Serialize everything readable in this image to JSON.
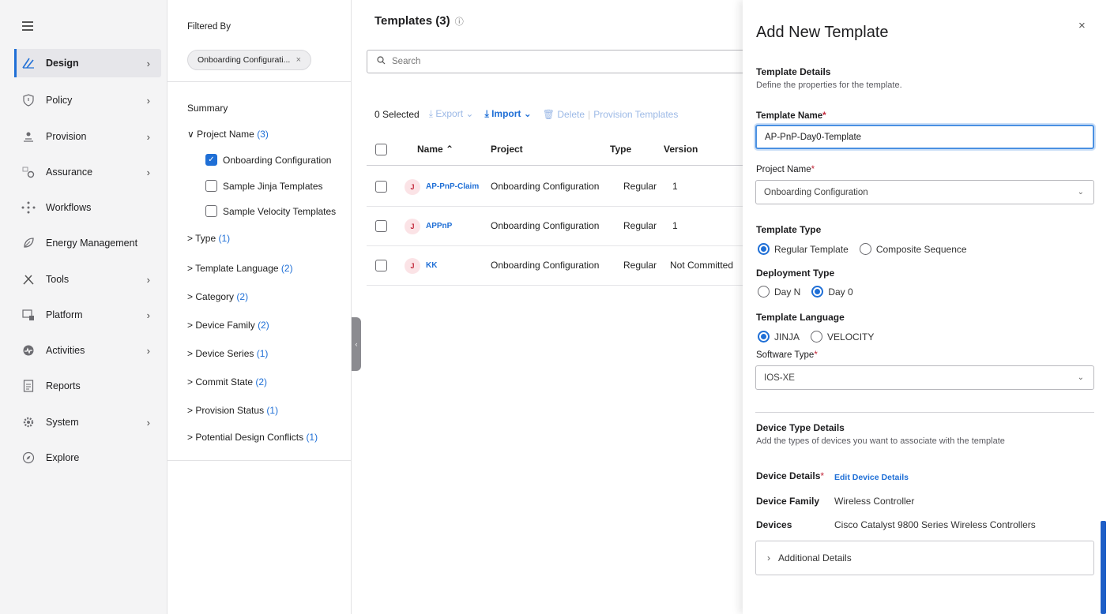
{
  "nav": {
    "items": [
      {
        "label": "Design",
        "icon": "design-icon",
        "chevron": true,
        "active": true
      },
      {
        "label": "Policy",
        "icon": "policy-icon",
        "chevron": true
      },
      {
        "label": "Provision",
        "icon": "provision-icon",
        "chevron": true
      },
      {
        "label": "Assurance",
        "icon": "assurance-icon",
        "chevron": true
      },
      {
        "label": "Workflows",
        "icon": "workflows-icon",
        "chevron": false
      },
      {
        "label": "Energy Management",
        "icon": "energy-icon",
        "chevron": false
      },
      {
        "label": "Tools",
        "icon": "tools-icon",
        "chevron": true
      },
      {
        "label": "Platform",
        "icon": "platform-icon",
        "chevron": true
      },
      {
        "label": "Activities",
        "icon": "activities-icon",
        "chevron": true
      },
      {
        "label": "Reports",
        "icon": "reports-icon",
        "chevron": false
      },
      {
        "label": "System",
        "icon": "system-icon",
        "chevron": true
      },
      {
        "label": "Explore",
        "icon": "explore-icon",
        "chevron": false
      }
    ],
    "chevron_glyph": "›"
  },
  "filter": {
    "title": "Filtered By",
    "chip": "Onboarding Configurati...",
    "chip_close": "×",
    "summary": "Summary",
    "project_name": {
      "label": "Project Name",
      "count": "(3)",
      "arrow": "∨"
    },
    "options": [
      {
        "label": "Onboarding Configuration",
        "checked": true
      },
      {
        "label": "Sample Jinja Templates",
        "checked": false
      },
      {
        "label": "Sample Velocity Templates",
        "checked": false
      }
    ],
    "facets": [
      {
        "label": "Type",
        "count": "(1)"
      },
      {
        "label": "Template Language",
        "count": "(2)"
      },
      {
        "label": "Category",
        "count": "(2)"
      },
      {
        "label": "Device Family",
        "count": "(2)"
      },
      {
        "label": "Device Series",
        "count": "(1)"
      },
      {
        "label": "Commit State",
        "count": "(2)"
      },
      {
        "label": "Provision Status",
        "count": "(1)"
      },
      {
        "label": "Potential Design Conflicts",
        "count": "(1)"
      }
    ],
    "facet_arrow": ">"
  },
  "main": {
    "title": "Templates (3)",
    "search_placeholder": "Search",
    "toolbar": {
      "selected": "0 Selected",
      "export": "⤓ Export ⌄",
      "import": "⤓ Import ⌄",
      "delete": "🗑 Delete",
      "provision": "Provision Templates"
    },
    "columns": [
      "Name ⌃",
      "Project",
      "Type",
      "Version"
    ],
    "rows": [
      {
        "badge": "J",
        "name": "AP-PnP-Claim",
        "project": "Onboarding Configuration",
        "type": "Regular",
        "version": "1"
      },
      {
        "badge": "J",
        "name": "APPnP",
        "project": "Onboarding Configuration",
        "type": "Regular",
        "version": "1"
      },
      {
        "badge": "J",
        "name": "KK",
        "project": "Onboarding Configuration",
        "type": "Regular",
        "version": "Not Committed"
      }
    ]
  },
  "drawer": {
    "title": "Add New Template",
    "close": "×",
    "details_heading": "Template Details",
    "details_sub": "Define the properties for the template.",
    "template_name_label": "Template Name",
    "template_name_value": "AP-PnP-Day0-Template",
    "project_name_label": "Project Name",
    "project_name_value": "Onboarding Configuration",
    "template_type_label": "Template Type",
    "template_type_options": [
      "Regular Template",
      "Composite Sequence"
    ],
    "deployment_type_label": "Deployment Type",
    "deployment_type_options": [
      "Day N",
      "Day 0"
    ],
    "template_language_label": "Template Language",
    "template_language_options": [
      "JINJA",
      "VELOCITY"
    ],
    "software_type_label": "Software Type",
    "software_type_value": "IOS-XE",
    "device_type_heading": "Device Type Details",
    "device_type_sub": "Add the types of devices you want to associate with the template",
    "device_details_label": "Device Details",
    "edit_device_details": "Edit Device Details",
    "device_family_label": "Device Family",
    "device_family_value": "Wireless Controller",
    "devices_label": "Devices",
    "devices_value": "Cisco Catalyst 9800 Series Wireless Controllers",
    "additional_details": "Additional Details",
    "required_mark": "*"
  }
}
